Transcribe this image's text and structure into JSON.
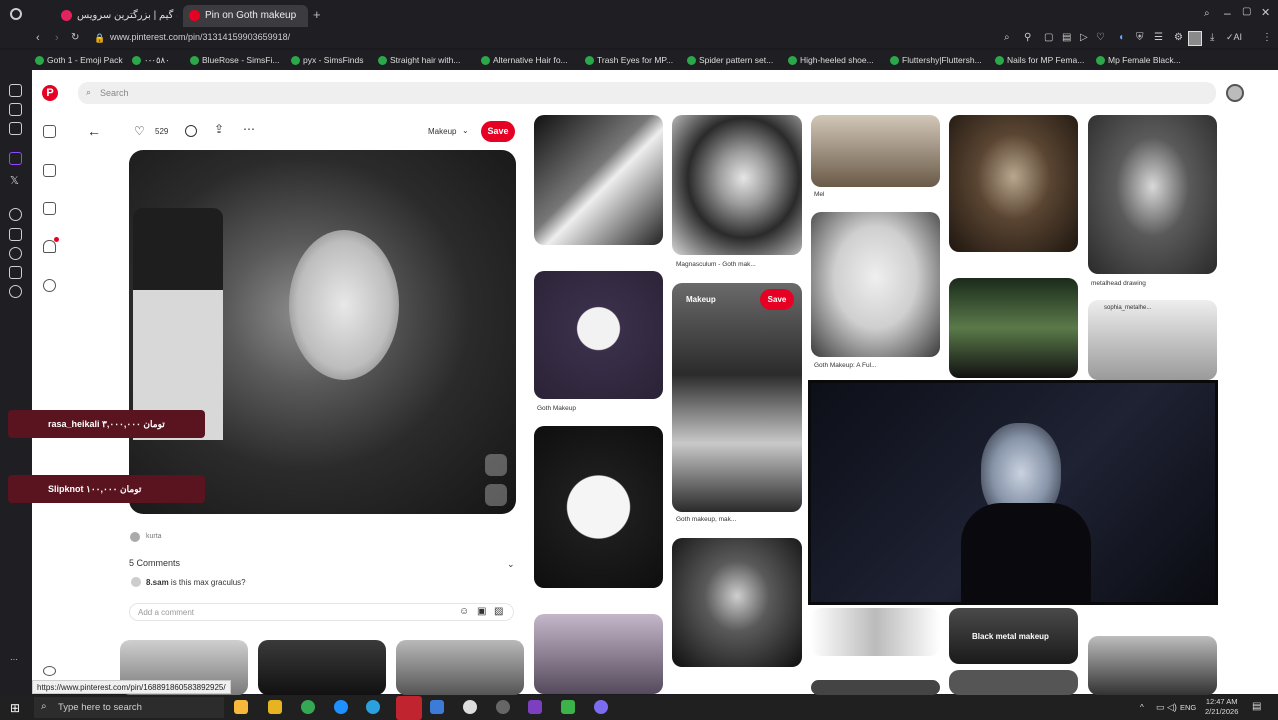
{
  "browser": {
    "tabs": [
      {
        "title": "آپارات گیم | بزرگترین سرویس",
        "active": false
      },
      {
        "title": "Pin on Goth makeup",
        "active": true
      }
    ],
    "url": "www.pinterest.com/pin/31314159903659918/",
    "bookmarks": [
      "Goth 1 - Emoji Pack",
      "٠٥٨٠-٠",
      "BlueRose - SimsFi...",
      "pyx - SimsFinds",
      "Straight hair with...",
      "Alternative Hair fo...",
      "Trash Eyes for MP...",
      "Spider pattern set...",
      "High-heeled shoe...",
      "Fluttershy|Fluttersh...",
      "Nails for MP Fema...",
      "Mp Female Black..."
    ]
  },
  "search": {
    "placeholder": "Search"
  },
  "pin": {
    "likes": "529",
    "board": "Makeup",
    "save": "Save",
    "author": "kurta",
    "comments_title": "5 Comments",
    "comment_user": "8.sam",
    "comment_text": "is this max graculus?",
    "add_comment": "Add a comment"
  },
  "grid": {
    "captions": {
      "c1": "Mel",
      "c2": "metalhead drawing",
      "c3": "Magnasculum - Goth mak...",
      "c4": "Goth Makeup",
      "c5": "Goth Makeup: A Ful...",
      "c6": "Goth makeup, mak...",
      "c7": "sophia_metalhe..."
    },
    "hover_board": "Makeup",
    "hover_save": "Save"
  },
  "overlays": {
    "donation1": "rasa_heikali ۳,۰۰۰,۰۰۰ تومان",
    "donation2": "Slipknot ۱۰۰,۰۰۰ تومان",
    "video_caption": "Black metal makeup"
  },
  "status_url": "https://www.pinterest.com/pin/168891860583892925/",
  "taskbar": {
    "search_placeholder": "Type here to search",
    "lang": "ENG",
    "time": "12:47 AM",
    "date": "2/21/2026"
  }
}
